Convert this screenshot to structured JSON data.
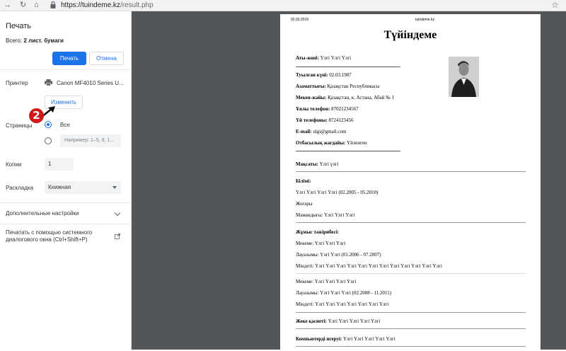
{
  "browser": {
    "url_host": "https://tuindeme.kz",
    "url_path": "/result.php"
  },
  "print_panel": {
    "title": "Печать",
    "total_label": "Всего:",
    "total_value": "2 лист. бумаги",
    "print_button": "Печать",
    "cancel_button": "Отмена",
    "printer_label": "Принтер",
    "printer_name": "Canon MF4010 Series U...",
    "change_button": "Изменить",
    "step_number": "2",
    "pages_label": "Страницы",
    "pages_all": "Все",
    "pages_placeholder": "Например: 1–5, 8, 1...",
    "copies_label": "Копии",
    "copies_value": "1",
    "layout_label": "Раскладка",
    "layout_value": "Книжная",
    "more_settings": "Дополнительные настройки",
    "system_dialog": "Печатать с помощью системного диалогового окна (Ctrl+Shift+P)"
  },
  "document": {
    "header_date": "02.03.2019",
    "header_site": "tuindeme.kz",
    "title": "Түйіндеме",
    "name_label": "Аты-жөні:",
    "name_value": "Үлгі Үлгі Үлгі",
    "birth_label": "Туылған күні:",
    "birth_value": "02.03.1987",
    "citizenship_label": "Азаматтығы:",
    "citizenship_value": "Қазақстан Республикасы",
    "address_label": "Мекен-жайы:",
    "address_value": "Қазақстан, к. Астана, Абай № 1",
    "mobile_label": "Ұялы телефон:",
    "mobile_value": "87021234567",
    "home_label": "Үй телефоны:",
    "home_value": "8724123456",
    "email_label": "E-mail:",
    "email_value": "ulgi@gmail.com",
    "family_label": "Отбасылық жағдайы:",
    "family_value": "Үйленген",
    "goal_label": "Мақсаты:",
    "goal_value": "Үлгі үлгі",
    "edu_label": "Білімі:",
    "edu_line1": "Үлгі Үлгі Үлгі Үлгі (02.2005 - 05.2010)",
    "edu_line2": "Жоғары",
    "edu_line3": "Мамандығы: Үлгі Үлгі Үлгі",
    "exp_label": "Жұмыс тәжірибесі:",
    "exp1_org": "Мекеме: Үлгі Үлгі Үлгі",
    "exp1_pos": "Лауазымы: Үлгі Үлгі (01.2006 - 07.2007)",
    "exp1_duty": "Міндеті: Үлгі Үлгі Үлгі Үлгі Үлгі Үлгі Үлгі Үлгі Үлгі Үлгі Үлгі Үлгі",
    "exp2_org": "Мекеме: Үлгі Үлгі Үлгі Үлгі",
    "exp2_pos": "Лауазымы: Үлгі Үлгі Үлгі (02.2008 - 11.2011)",
    "exp2_duty": "Міндеті: Үлгі Үлгі Үлгі Үлгі Үлгі Үлгі Үлгі",
    "personal_label": "Жеке қасиеті:",
    "personal_value": "Үлгі Үлгі Үлгі Үлгі Үлгі",
    "computer_label": "Компьютерді игеруі:",
    "computer_value": "Үлгі Үлгі Үлгі Үлгі Үлгі"
  }
}
